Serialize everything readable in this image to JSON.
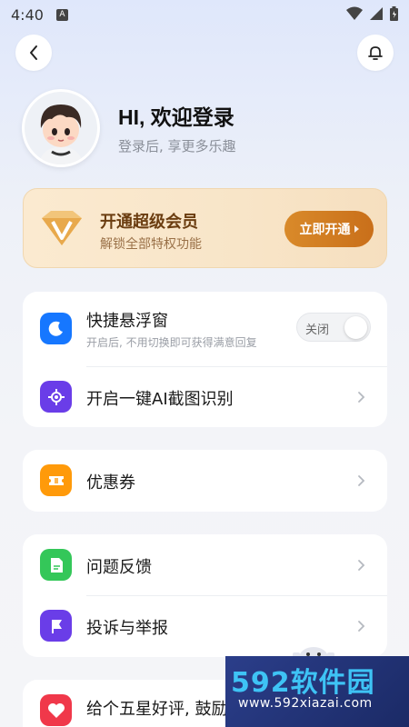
{
  "status_bar": {
    "time": "4:40",
    "notif_letter": "A"
  },
  "profile": {
    "title": "HI, 欢迎登录",
    "subtitle": "登录后, 享更多乐趣"
  },
  "vip": {
    "title": "开通超级会员",
    "subtitle": "解锁全部特权功能",
    "button": "立即开通",
    "accent": "#c96f1a"
  },
  "sections": {
    "floating_window": {
      "label": "快捷悬浮窗",
      "sub": "开启后, 不用切换即可获得满意回复",
      "toggle_text": "关闭",
      "icon": "moon-icon",
      "color": "#1677ff"
    },
    "ai_screenshot": {
      "label": "开启一键AI截图识别",
      "icon": "crosshair-icon",
      "color": "#6a3de8"
    },
    "coupon": {
      "label": "优惠券",
      "icon": "ticket-icon",
      "color": "#ff9a0a"
    },
    "feedback": {
      "label": "问题反馈",
      "icon": "document-icon",
      "color": "#34c759"
    },
    "report": {
      "label": "投诉与举报",
      "icon": "flag-icon",
      "color": "#6a3de8"
    },
    "rate": {
      "label": "给个五星好评, 鼓励一下",
      "icon": "heart-icon",
      "color": "#f0384a"
    }
  },
  "watermark": {
    "logo": "592软件园",
    "url": "www.592xiazai.com"
  }
}
